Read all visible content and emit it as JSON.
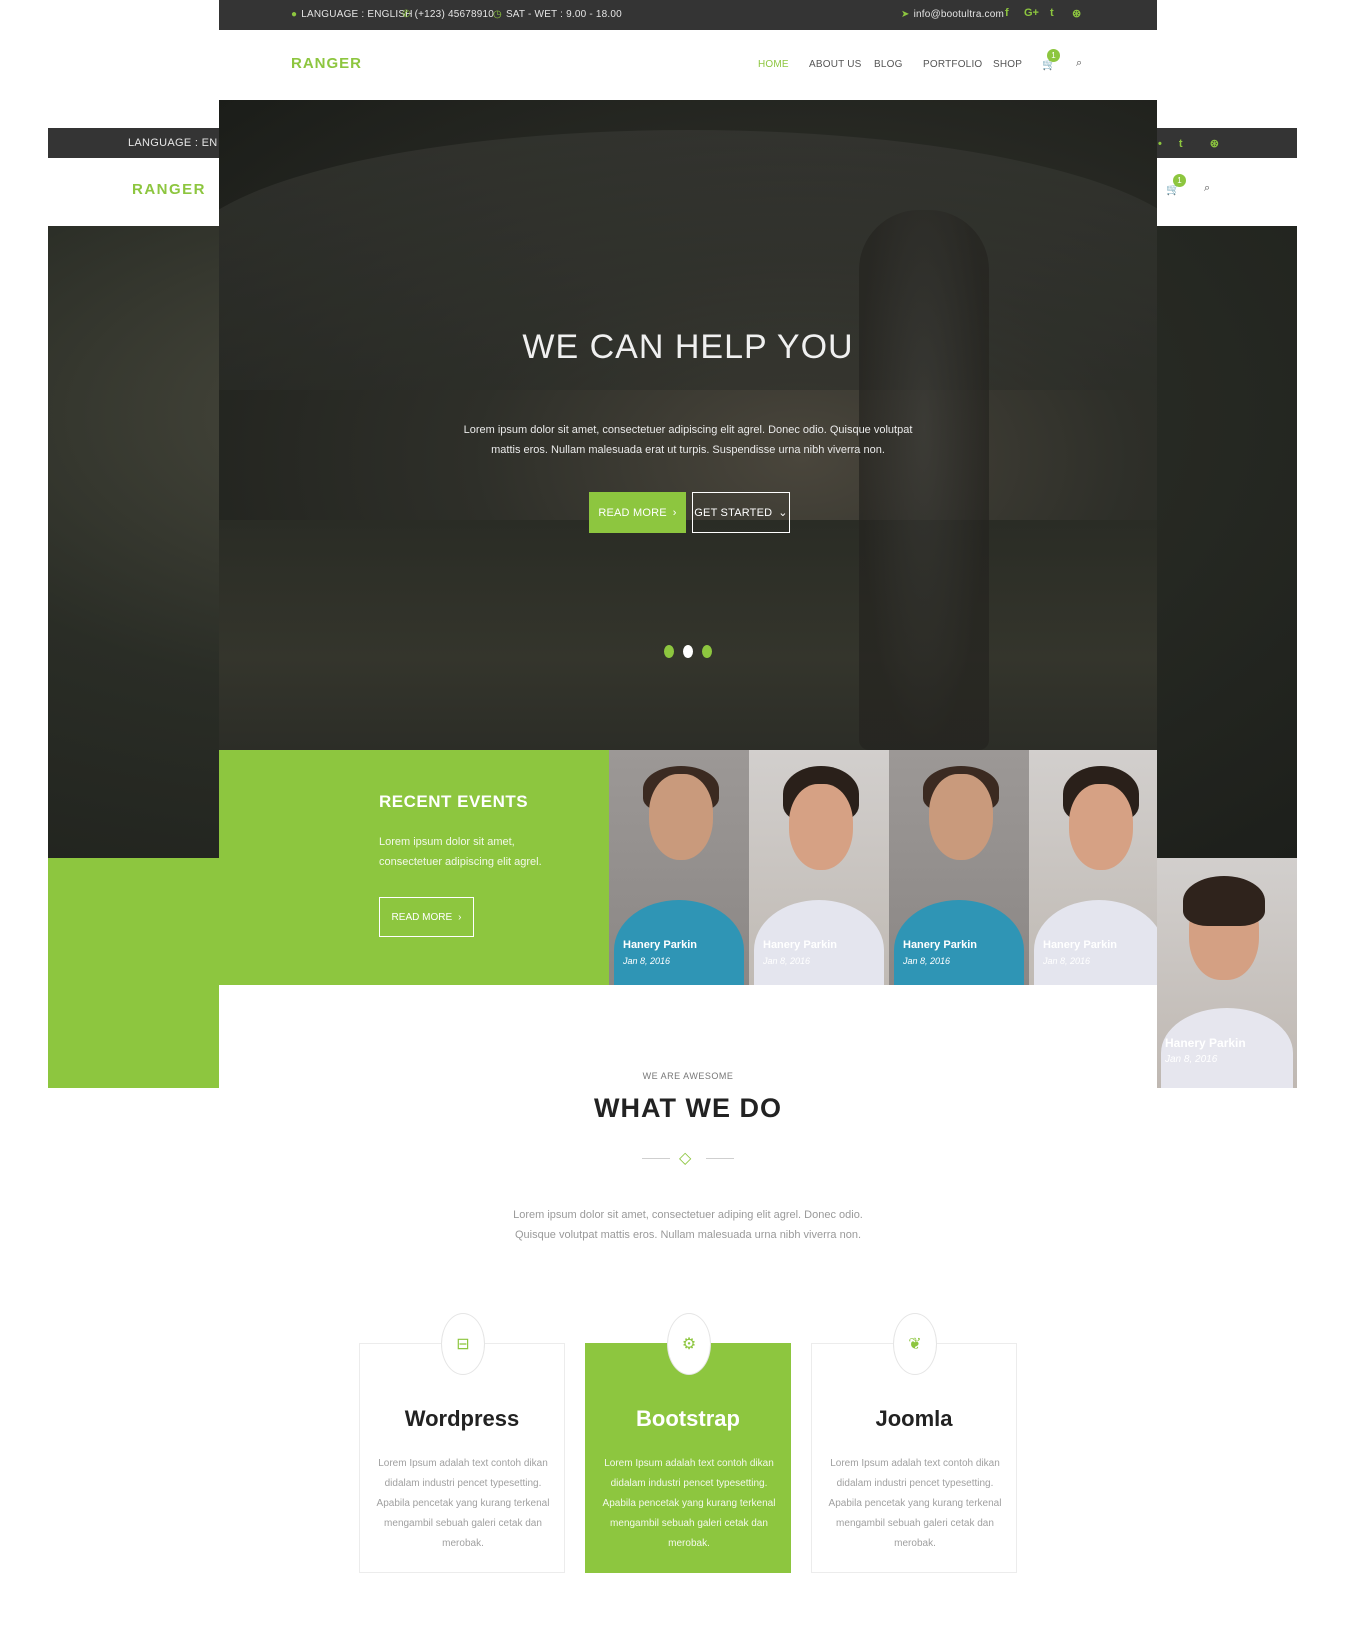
{
  "topbar": {
    "language": "LANGUAGE : ENGLISH",
    "phone": "(+123) 45678910",
    "hours": "SAT - WET : 9.00 - 18.00",
    "email": "info@bootultra.com",
    "social": [
      "f",
      "G+",
      "t",
      "d"
    ]
  },
  "background_copy": {
    "language": "LANGUAGE : EN",
    "logo": "RANGER",
    "cart_count": "1",
    "person_name": "Hanery Parkin",
    "person_date": "Jan 8, 2016"
  },
  "navbar": {
    "logo": "RANGER",
    "items": [
      "HOME",
      "ABOUT US",
      "BLOG",
      "PORTFOLIO",
      "SHOP"
    ],
    "active": "HOME",
    "cart_count": "1"
  },
  "hero": {
    "title": "WE CAN HELP YOU",
    "text": "Lorem ipsum dolor sit amet, consectetuer adipiscing elit agrel. Donec odio. Quisque volutpat mattis eros. Nullam malesuada erat ut turpis. Suspendisse urna nibh viverra non.",
    "read_more": "READ MORE",
    "get_started": "GET STARTED",
    "slides": 3,
    "active_slide": 2
  },
  "events": {
    "title": "RECENT EVENTS",
    "text": "Lorem ipsum dolor sit amet, consectetuer adipiscing elit agrel.",
    "button": "READ MORE",
    "people": [
      {
        "name": "Hanery Parkin",
        "date": "Jan 8, 2016"
      },
      {
        "name": "Hanery Parkin",
        "date": "Jan 8, 2016"
      },
      {
        "name": "Hanery Parkin",
        "date": "Jan 8, 2016"
      },
      {
        "name": "Hanery Parkin",
        "date": "Jan 8, 2016"
      }
    ]
  },
  "what_we_do": {
    "kicker": "WE ARE AWESOME",
    "heading": "WHAT WE DO",
    "text": "Lorem ipsum dolor sit amet, consectetuer adiping elit agrel. Donec odio. Quisque volutpat mattis eros. Nullam malesuada urna nibh viverra non."
  },
  "services": [
    {
      "title": "Wordpress",
      "icon": "inbox-icon",
      "text": "Lorem Ipsum adalah text contoh dikan didalam industri pencet typesetting. Apabila pencetak yang kurang terkenal mengambil sebuah galeri cetak dan merobak."
    },
    {
      "title": "Bootstrap",
      "icon": "gear-icon",
      "text": "Lorem Ipsum adalah text contoh dikan didalam industri pencet typesetting. Apabila pencetak yang kurang terkenal mengambil sebuah galeri cetak dan merobak."
    },
    {
      "title": "Joomla",
      "icon": "leaf-icon",
      "text": "Lorem Ipsum adalah text contoh dikan didalam industri pencet typesetting. Apabila pencetak yang kurang terkenal mengambil sebuah galeri cetak dan merobak."
    }
  ],
  "colors": {
    "accent": "#8dc63f",
    "topbar": "#343434",
    "heading": "#222222"
  }
}
